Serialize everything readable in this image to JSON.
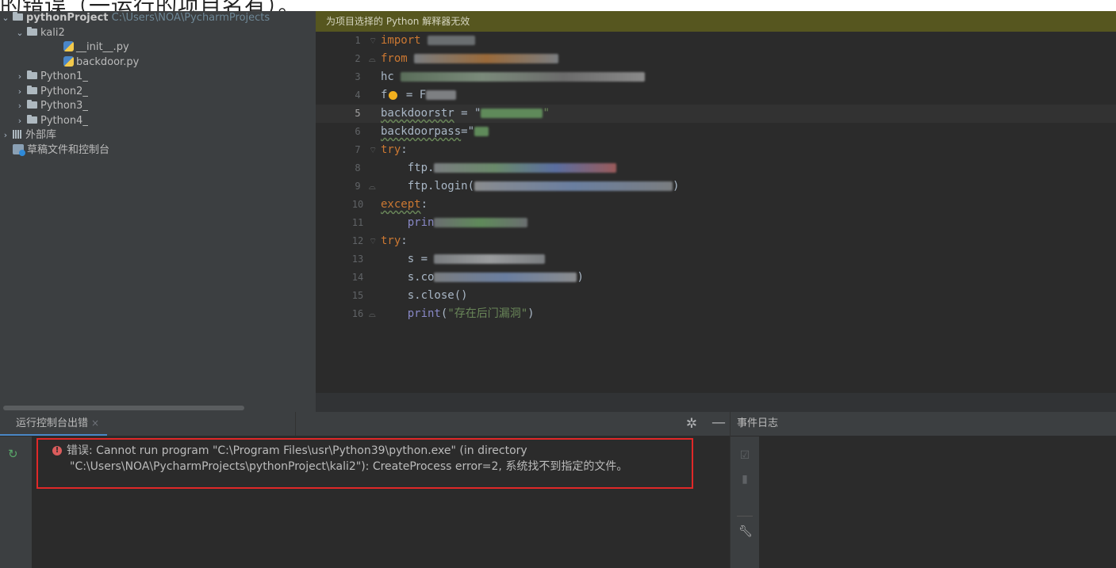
{
  "top_caption": "的错误（一运行的项目名有）。",
  "project": {
    "root_name": "pythonProject",
    "root_path": "C:\\Users\\NOA\\PycharmProjects",
    "items": [
      {
        "label": "kali2"
      },
      {
        "label": "__init__.py"
      },
      {
        "label": "backdoor.py"
      },
      {
        "label": "Python1_"
      },
      {
        "label": "Python2_"
      },
      {
        "label": "Python3_"
      },
      {
        "label": "Python4_"
      },
      {
        "label": "外部库"
      },
      {
        "label": "草稿文件和控制台"
      }
    ]
  },
  "editor": {
    "banner": "为项目选择的 Python 解释器无效",
    "line_numbers": [
      "1",
      "2",
      "3",
      "4",
      "5",
      "6",
      "7",
      "8",
      "9",
      "10",
      "11",
      "12",
      "13",
      "14",
      "15",
      "16"
    ],
    "current_line": "5",
    "code": {
      "l1_kw": "import",
      "l2_kw": "from",
      "l3_text": "hc",
      "l4_text": "f",
      "l4_rest": " = F",
      "l5_var": "backdoorstr",
      "l5_rest": " = \"",
      "l6_var": "backdoorpass",
      "l6_rest": "=\"",
      "l7_kw": "try",
      "l7_colon": ":",
      "l8_text": "ftp.",
      "l9_text": "ftp.login(",
      "l9_end": ")",
      "l10_kw": "except",
      "l10_colon": ":",
      "l11_text": "prin",
      "l12_kw": "try",
      "l12_colon": ":",
      "l13_text": "s = ",
      "l14_text": "s.co",
      "l14_end": ")",
      "l15_text": "s.close()",
      "l16_fn": "print",
      "l16_open": "(",
      "l16_str": "\"存在后门漏洞\"",
      "l16_close": ")"
    }
  },
  "run": {
    "tab_label": "运行控制台出错",
    "tab_close": "×",
    "error_prefix": "错误:",
    "error_line1": "Cannot run program \"C:\\Program Files\\usr\\Python39\\python.exe\" (in directory",
    "error_line2": "\"C:\\Users\\NOA\\PycharmProjects\\pythonProject\\kali2\"): CreateProcess error=2, 系统找不到指定的文件。"
  },
  "event_log": {
    "title": "事件日志"
  },
  "colors": {
    "banner_bg": "#56561f",
    "error_border": "#e02828",
    "keyword": "#cc7832",
    "string": "#6a8759"
  }
}
